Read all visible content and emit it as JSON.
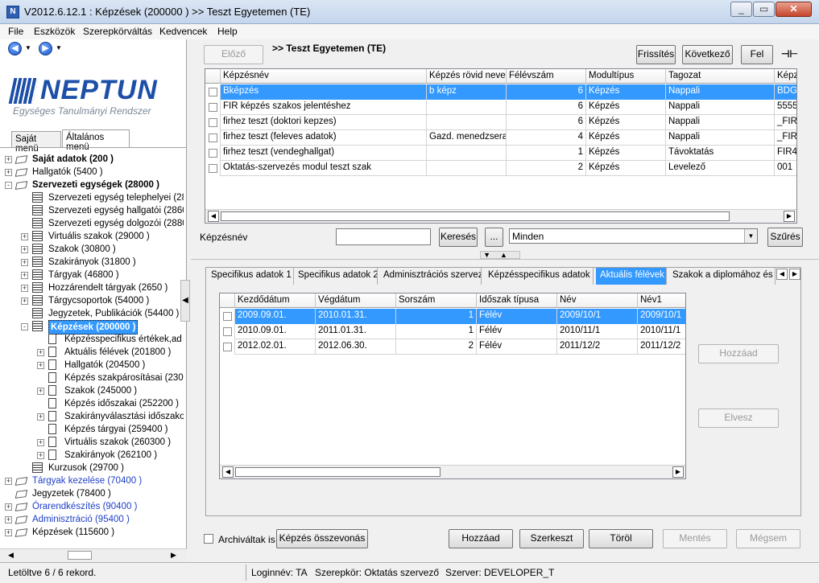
{
  "window": {
    "title": "V2012.6.12.1 : Képzések (200000  ) >> Teszt Egyetemen (TE)",
    "icon_letter": "N"
  },
  "menu": [
    "File",
    "Eszközök",
    "Szerepkörváltás",
    "Kedvencek",
    "Help"
  ],
  "logo": {
    "word": "NEPTUN",
    "subtitle": "Egységes Tanulmányi Rendszer"
  },
  "left_tabs": [
    "Saját menü",
    "Általános menü"
  ],
  "tree": [
    {
      "label": "Saját adatok (200 )",
      "level": 0,
      "exp": "+",
      "icon": "folder",
      "style": "bold"
    },
    {
      "label": "Hallgatók (5400  )",
      "level": 0,
      "exp": "+",
      "icon": "folder",
      "style": ""
    },
    {
      "label": "Szervezeti egységek (28000  )",
      "level": 0,
      "exp": "-",
      "icon": "folder",
      "style": "bold"
    },
    {
      "label": "Szervezeti egység telephelyei (28",
      "level": 1,
      "exp": "",
      "icon": "grid",
      "style": ""
    },
    {
      "label": "Szervezeti egység hallgatói (2860",
      "level": 1,
      "exp": "",
      "icon": "grid",
      "style": ""
    },
    {
      "label": "Szervezeti egység dolgozói (2880",
      "level": 1,
      "exp": "",
      "icon": "grid",
      "style": ""
    },
    {
      "label": "Virtuális szakok (29000  )",
      "level": 1,
      "exp": "+",
      "icon": "grid",
      "style": ""
    },
    {
      "label": "Szakok (30800  )",
      "level": 1,
      "exp": "+",
      "icon": "grid",
      "style": ""
    },
    {
      "label": "Szakirányok (31800  )",
      "level": 1,
      "exp": "+",
      "icon": "grid",
      "style": ""
    },
    {
      "label": "Tárgyak (46800  )",
      "level": 1,
      "exp": "+",
      "icon": "grid",
      "style": ""
    },
    {
      "label": "Hozzárendelt tárgyak (2650  )",
      "level": 1,
      "exp": "+",
      "icon": "grid",
      "style": ""
    },
    {
      "label": "Tárgycsoportok (54000  )",
      "level": 1,
      "exp": "+",
      "icon": "grid",
      "style": ""
    },
    {
      "label": "Jegyzetek, Publikációk (54400  )",
      "level": 1,
      "exp": "",
      "icon": "grid",
      "style": ""
    },
    {
      "label": "Képzések (200000  )",
      "level": 1,
      "exp": "-",
      "icon": "grid",
      "style": "selected"
    },
    {
      "label": "Képzésspecifikus értékek,ad",
      "level": 2,
      "exp": "",
      "icon": "doc",
      "style": ""
    },
    {
      "label": "Aktuális félévek (201800  )",
      "level": 2,
      "exp": "+",
      "icon": "doc",
      "style": ""
    },
    {
      "label": "Hallgatók (204500  )",
      "level": 2,
      "exp": "+",
      "icon": "doc",
      "style": ""
    },
    {
      "label": "Képzés szakpárosításai (230",
      "level": 2,
      "exp": "",
      "icon": "doc",
      "style": ""
    },
    {
      "label": "Szakok (245000  )",
      "level": 2,
      "exp": "+",
      "icon": "doc",
      "style": ""
    },
    {
      "label": "Képzés időszakai (252200  )",
      "level": 2,
      "exp": "",
      "icon": "doc",
      "style": ""
    },
    {
      "label": "Szakirányválasztási időszako",
      "level": 2,
      "exp": "+",
      "icon": "doc",
      "style": ""
    },
    {
      "label": "Képzés tárgyai (259400  )",
      "level": 2,
      "exp": "",
      "icon": "doc",
      "style": ""
    },
    {
      "label": "Virtuális szakok (260300  )",
      "level": 2,
      "exp": "+",
      "icon": "doc",
      "style": ""
    },
    {
      "label": "Szakirányok (262100  )",
      "level": 2,
      "exp": "+",
      "icon": "doc",
      "style": ""
    },
    {
      "label": "Kurzusok (29700  )",
      "level": 1,
      "exp": "",
      "icon": "grid",
      "style": ""
    },
    {
      "label": "Tárgyak kezelése (70400  )",
      "level": 0,
      "exp": "+",
      "icon": "folder",
      "style": "blue"
    },
    {
      "label": "Jegyzetek (78400  )",
      "level": 0,
      "exp": "",
      "icon": "folder",
      "style": ""
    },
    {
      "label": "Órarendkészítés (90400  )",
      "level": 0,
      "exp": "+",
      "icon": "folder",
      "style": "blue"
    },
    {
      "label": "Adminisztráció (95400  )",
      "level": 0,
      "exp": "+",
      "icon": "folder",
      "style": "blue"
    },
    {
      "label": "Képzések (115600  )",
      "level": 0,
      "exp": "+",
      "icon": "folder",
      "style": ""
    }
  ],
  "toolbar": {
    "prev_label": "Előző",
    "breadcrumb": ">> Teszt Egyetemen (TE)",
    "refresh_label": "Frissítés",
    "next_label": "Következő",
    "up_label": "Fel",
    "pin_icon": "⊣⊢"
  },
  "main_grid": {
    "columns": [
      "Képzésnév",
      "Képzés rövid neve",
      "Félévszám",
      "Modultípus",
      "Tagozat",
      "Képz"
    ],
    "rows": [
      [
        "Bképzés",
        "b képz",
        "6",
        "Képzés",
        "Nappali",
        "BDG"
      ],
      [
        "FIR képzés szakos jelentéshez",
        "",
        "6",
        "Képzés",
        "Nappali",
        "5555"
      ],
      [
        "firhez teszt (doktori kepzes)",
        "",
        "6",
        "Képzés",
        "Nappali",
        "_FIR"
      ],
      [
        "firhez teszt (feleves adatok)",
        "Gazd. menedzserasszi",
        "4",
        "Képzés",
        "Nappali",
        "_FIR"
      ],
      [
        "firhez teszt (vendeghallgat)",
        "",
        "1",
        "Képzés",
        "Távoktatás",
        "FIR4"
      ],
      [
        "Oktatás-szervezés modul teszt szak",
        "",
        "2",
        "Képzés",
        "Levelező",
        "001"
      ]
    ]
  },
  "search": {
    "label": "Képzésnév",
    "input_value": "",
    "search_button": "Keresés",
    "dots_button": "...",
    "filter_value": "Minden",
    "filter_button": "Szűrés"
  },
  "tabs": [
    "Specifikus adatok 1",
    "Specifikus adatok 2",
    "Adminisztrációs szervezet",
    "Képzésspecifikus adatok 2",
    "Aktuális félévek",
    "Szakok a diplomához és vé"
  ],
  "active_tab": "Aktuális félévek",
  "sub_grid": {
    "columns": [
      "Kezdődátum",
      "Végdátum",
      "Sorszám",
      "Időszak típusa",
      "Név",
      "Név1"
    ],
    "rows": [
      [
        "2009.09.01.",
        "2010.01.31.",
        "1",
        "Félév",
        "2009/10/1",
        "2009/10/1"
      ],
      [
        "2010.09.01.",
        "2011.01.31.",
        "1",
        "Félév",
        "2010/11/1",
        "2010/11/1"
      ],
      [
        "2012.02.01.",
        "2012.06.30.",
        "2",
        "Félév",
        "2011/12/2",
        "2011/12/2"
      ]
    ]
  },
  "side_buttons": {
    "add": "Hozzáad",
    "delete": "Elvesz"
  },
  "bottom": {
    "archived_label": "Archiváltak is",
    "merge": "Képzés összevonás",
    "add": "Hozzáad",
    "edit": "Szerkeszt",
    "delete": "Töröl",
    "save": "Mentés",
    "cancel": "Mégsem"
  },
  "status": {
    "records": "Letöltve 6 / 6 rekord.",
    "login": "Loginnév: TA",
    "role": "Szerepkör: Oktatás szervező",
    "server": "Szerver: DEVELOPER_T"
  }
}
